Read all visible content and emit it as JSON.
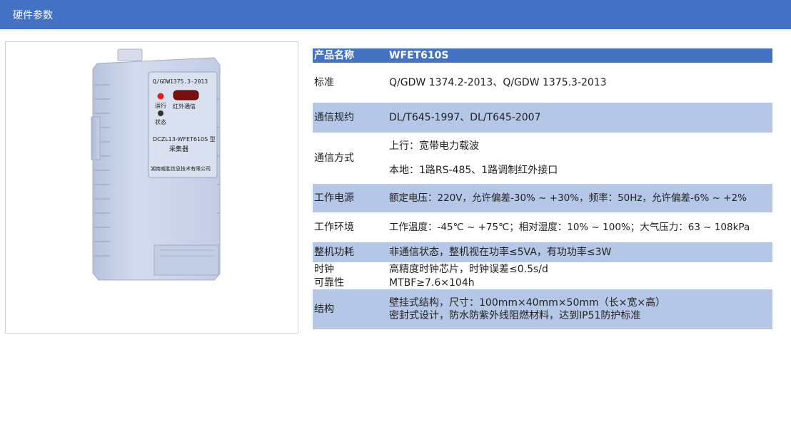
{
  "header": {
    "title": "硬件参数"
  },
  "device": {
    "label_standard": "Q/GDW1375.3-2013",
    "label_run": "运行",
    "label_ir": "红外通信",
    "label_status": "状态",
    "label_model": "DCZL13-WFET610S 型",
    "label_type": "采集器",
    "label_company": "湖南威胜信息技术有限公司"
  },
  "table": {
    "head": {
      "key": "产品名称",
      "value": "WFET610S"
    },
    "rows": [
      {
        "key": "标准",
        "lines": [
          "Q/GDW 1374.2-2013、Q/GDW 1375.3-2013"
        ]
      },
      {
        "key": "通信规约",
        "lines": [
          "DL/T645-1997、DL/T645-2007"
        ]
      },
      {
        "key": "通信方式",
        "lines": [
          "上行：宽带电力载波",
          "本地：1路RS-485、1路调制红外接口"
        ]
      },
      {
        "key": "工作电源",
        "lines": [
          "额定电压：220V，允许偏差-30% ~ +30%，频率：50Hz，允许偏差-6% ~ +2%"
        ]
      },
      {
        "key": "工作环境",
        "lines": [
          "工作温度：-45℃ ~ +75℃；相对湿度：10% ~ 100%；大气压力：63 ~ 108kPa"
        ]
      },
      {
        "key": "整机功耗",
        "lines": [
          "非通信状态，整机视在功率≤5VA，有功功率≤3W"
        ]
      },
      {
        "key": "时钟",
        "lines": [
          "高精度时钟芯片，时钟误差≤0.5s/d"
        ]
      },
      {
        "key": "可靠性",
        "lines": [
          "MTBF≥7.6×104h"
        ]
      },
      {
        "key": "结构",
        "lines": [
          "壁挂式结构，尺寸：100mm×40mm×50mm（长×宽×高）",
          "密封式设计，防水防紫外线阻燃材料，达到IP51防护标准"
        ]
      }
    ]
  },
  "colors": {
    "header_bg": "#4472c4",
    "row_shade": "#b4c7e7",
    "device_body": "#c9d3ea"
  }
}
